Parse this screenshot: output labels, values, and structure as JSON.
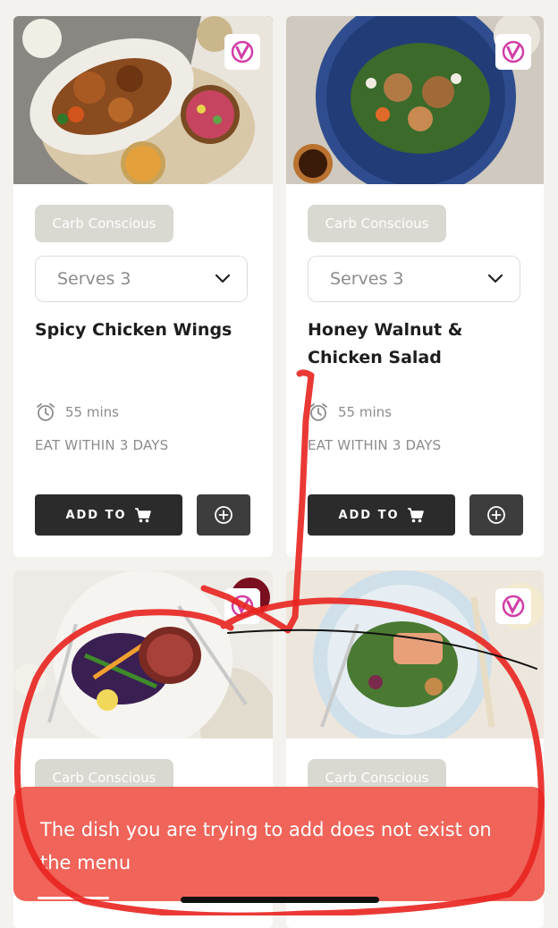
{
  "cards": [
    {
      "diet_tag": "Carb Conscious",
      "serves": "Serves 3",
      "title": "Spicy Chicken Wings",
      "time": "55 mins",
      "eat_within": "EAT WITHIN 3 DAYS",
      "add_label": "ADD TO"
    },
    {
      "diet_tag": "Carb Conscious",
      "serves": "Serves 3",
      "title": "Honey Walnut & Chicken Salad",
      "time": "55 mins",
      "eat_within": "EAT WITHIN 3 DAYS",
      "add_label": "ADD TO"
    },
    {
      "diet_tag": "Carb Conscious"
    },
    {
      "diet_tag": "Carb Conscious"
    }
  ],
  "toast": {
    "message": "The dish you are trying to add does not exist on the menu"
  },
  "colors": {
    "toast_bg": "#f0645a",
    "badge_accent": "#d23ea6",
    "button_dark": "#2b2b2b"
  }
}
